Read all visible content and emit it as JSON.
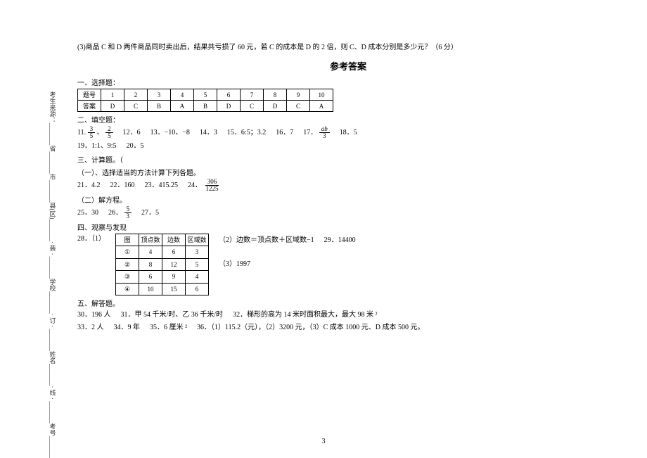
{
  "binding": {
    "text": "考生来源：_______省_______市_______县(区)_______· 装 · _______学校_______· 订 · _______姓名_______· 线 · _______考号_______"
  },
  "question3": "(3)商品 C 和 D 两件商品同时卖出后，结果共亏损了 60 元，若 C 的成本是 D 的 2 倍，则 C、D 成本分别是多少元？（6 分）",
  "answer_title": "参考答案",
  "sections": {
    "s1": "一、选择题：",
    "s2": "二、填空题：",
    "s3": "三、计算题。（",
    "s3a": "（一）、选择适当的方法计算下列各题。",
    "s3b": "（二）解方程。",
    "s4": "四、观察与发现",
    "s5": "五、解答题。"
  },
  "choice": {
    "header": [
      "题号",
      "1",
      "2",
      "3",
      "4",
      "5",
      "6",
      "7",
      "8",
      "9",
      "10"
    ],
    "answers": [
      "答案",
      "D",
      "C",
      "B",
      "A",
      "B",
      "D",
      "C",
      "D",
      "C",
      "A"
    ]
  },
  "fill": {
    "r1": {
      "n11": "11.",
      "f11a_num": "3",
      "f11a_den": "5",
      "sep": "、",
      "f11b_num": "2",
      "f11b_den": "5",
      "n12": "12．6",
      "n13": "13．−10、−8",
      "n14": "14．3",
      "n15": "15．6:5；3.2",
      "n16": "16．7",
      "n17": "17．",
      "f17_num": "ab",
      "f17_den": "3",
      "n18": "18．5"
    },
    "r2": {
      "n19": "19．1:1、9:5",
      "n20": "20．5"
    }
  },
  "calc1": {
    "n21": "21．4.2",
    "n22": "22．160",
    "n23": "23．415.25",
    "n24": "24．",
    "f24_num": "306",
    "f24_den": "1225"
  },
  "calc2": {
    "n25": "25．30",
    "n26": "26．",
    "f26_num": "5",
    "f26_den": "3",
    "n27": "27．5"
  },
  "observe": {
    "n28": "28．（1）",
    "header": [
      "图",
      "顶点数",
      "边数",
      "区域数"
    ],
    "rows": [
      [
        "①",
        "4",
        "6",
        "3"
      ],
      [
        "②",
        "8",
        "12",
        "5"
      ],
      [
        "③",
        "6",
        "9",
        "4"
      ],
      [
        "④",
        "10",
        "15",
        "6"
      ]
    ],
    "side1": "（2）边数＝顶点数＋区域数−1",
    "side1b": "29．14400",
    "side2": "（3）1997"
  },
  "solve": {
    "r1": {
      "n30": "30．196 人",
      "n31": "31．甲 54 千米/时、乙 36 千米/时",
      "n32": "32．梯形的高为 14 米时面积最大，最大 98 米 ²"
    },
    "r2": {
      "n33": "33．2 人",
      "n34": "34．9 年",
      "n35": "35．6 厘米 ²",
      "n36": "36．（1）115.2（元），（2）3200 元，（3）C 成本 1000 元、D 成本 500 元。"
    }
  },
  "page_num": "3"
}
